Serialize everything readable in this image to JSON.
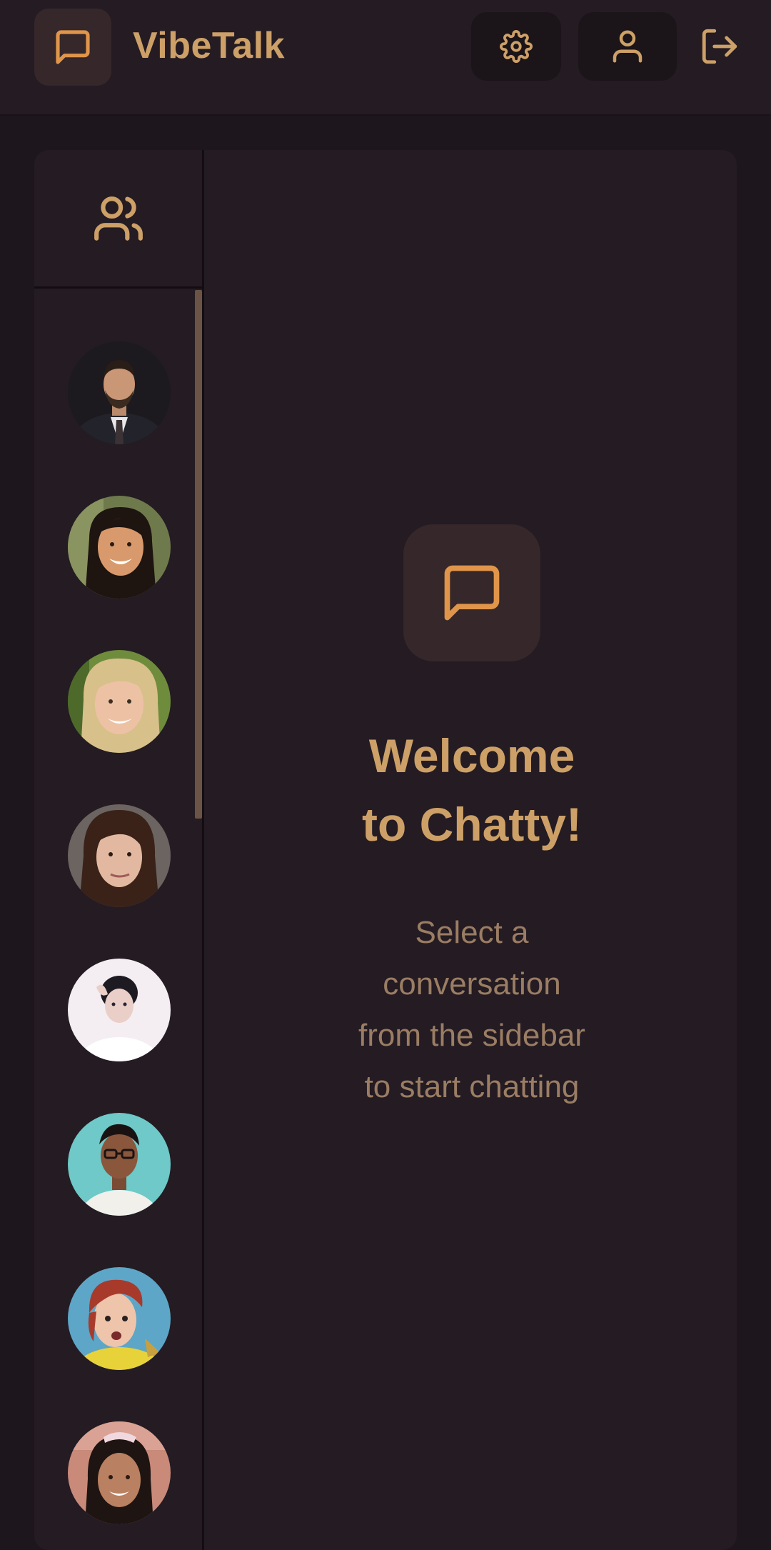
{
  "header": {
    "app_name": "VibeTalk",
    "logo_icon": "message-square-icon",
    "settings_icon": "gear-icon",
    "profile_icon": "user-icon",
    "logout_icon": "logout-icon"
  },
  "sidebar": {
    "header_icon": "users-icon",
    "contacts": [
      {
        "avatar": "avatar-man-suit"
      },
      {
        "avatar": "avatar-woman-smiling"
      },
      {
        "avatar": "avatar-woman-blonde"
      },
      {
        "avatar": "avatar-woman-brunette"
      },
      {
        "avatar": "avatar-woman-white-background"
      },
      {
        "avatar": "avatar-woman-glasses"
      },
      {
        "avatar": "avatar-woman-red-hair"
      },
      {
        "avatar": "avatar-woman-partial"
      }
    ]
  },
  "main": {
    "welcome_icon": "message-square-icon",
    "title_line1": "Welcome",
    "title_line2": "to Chatty!",
    "subtitle_line1": "Select a",
    "subtitle_line2": "conversation",
    "subtitle_line3": "from the sidebar",
    "subtitle_line4": "to start chatting"
  },
  "colors": {
    "accent": "#cda067",
    "icon_orange": "#e0954a",
    "background": "#1e161d",
    "panel": "#241b23",
    "muted_text": "#9a7d63"
  }
}
